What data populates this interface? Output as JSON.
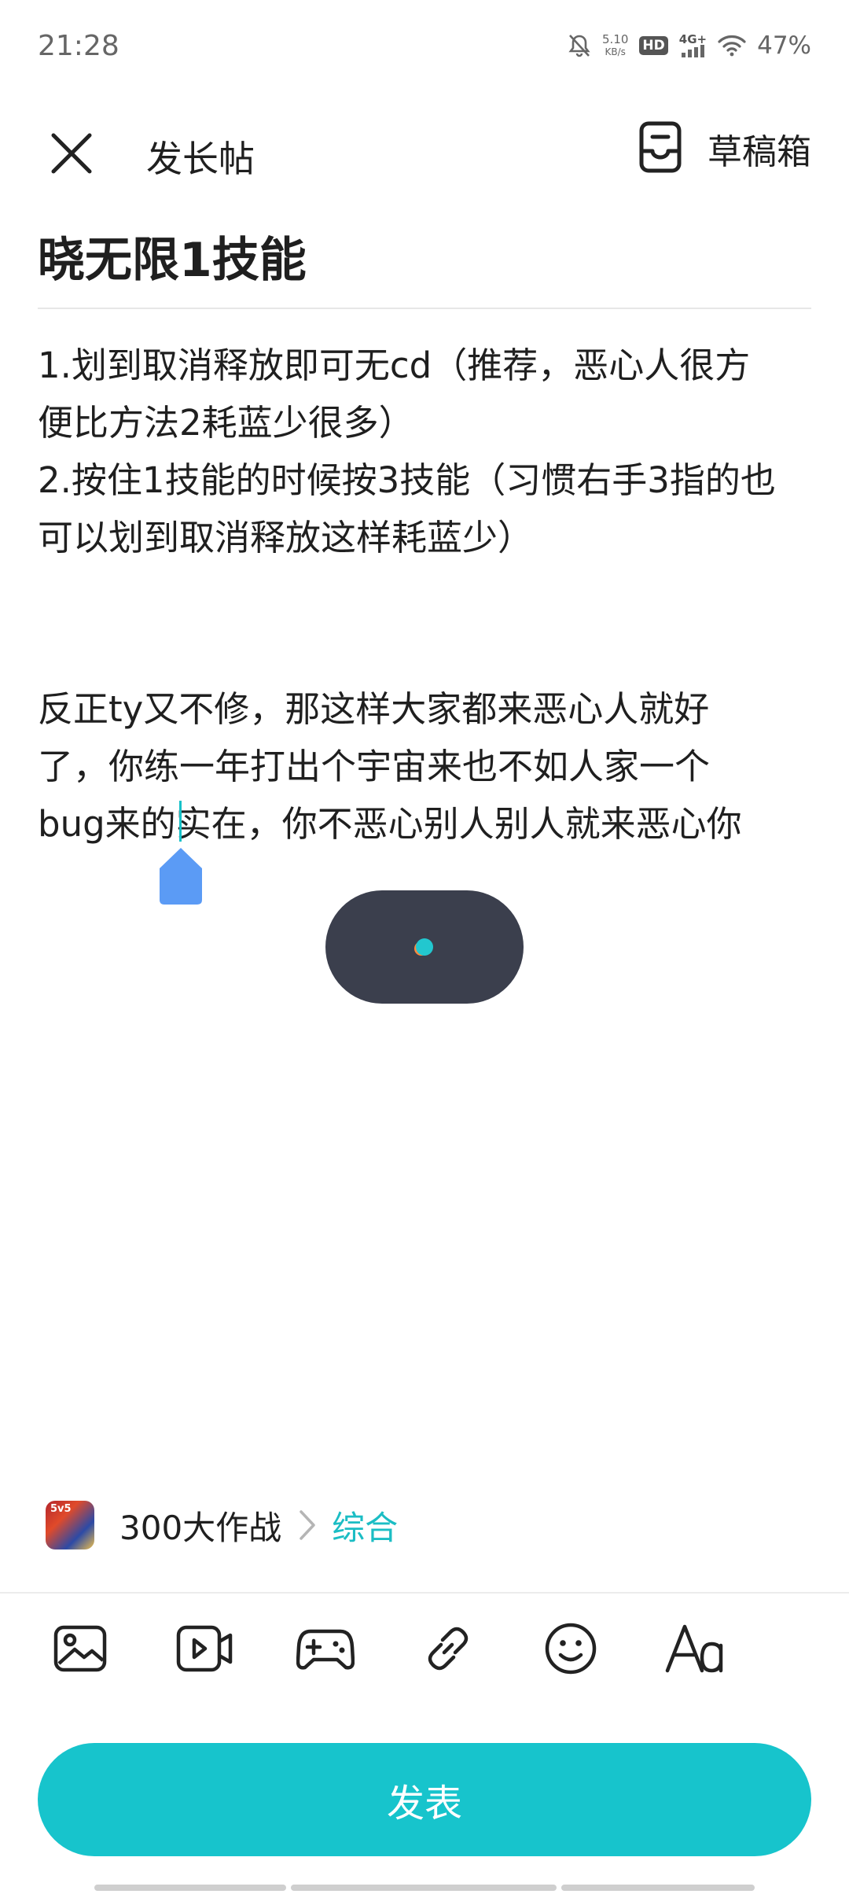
{
  "status_bar": {
    "time": "21:28",
    "net_speed_value": "5.10",
    "net_speed_unit": "KB/s",
    "hd_label": "HD",
    "signal_label": "4G+",
    "battery": "47%",
    "icons": [
      "mute-icon",
      "wifi-icon",
      "signal-icon"
    ]
  },
  "header": {
    "close_icon": "close-icon",
    "title": "发长帖",
    "drafts_icon": "drafts-box-icon",
    "drafts_label": "草稿箱"
  },
  "post": {
    "title": "晓无限1技能",
    "body_lines": [
      "1.划到取消释放即可无cd（推荐，恶心人很方",
      "便比方法2耗蓝少很多）",
      "2.按住1技能的时候按3技能（习惯右手3指的也",
      "可以划到取消释放这样耗蓝少）",
      "反正ty又不修，那这样大家都来恶心人就好",
      "了，你练一年打出个宇宙来也不如人家一个",
      "bug来的实在，你不恶心别人别人就来恶心你"
    ]
  },
  "forum": {
    "logo_text": "5v5",
    "name": "300大作战",
    "category": "综合"
  },
  "toolbar": {
    "items": [
      "image-icon",
      "video-icon",
      "game-icon",
      "link-icon",
      "emoji-icon",
      "text-format-icon"
    ]
  },
  "publish": {
    "label": "发表"
  },
  "colors": {
    "accent": "#17c4cc",
    "loading_pill": "#3b3f4d",
    "caret_handle": "#5b9bf5"
  }
}
